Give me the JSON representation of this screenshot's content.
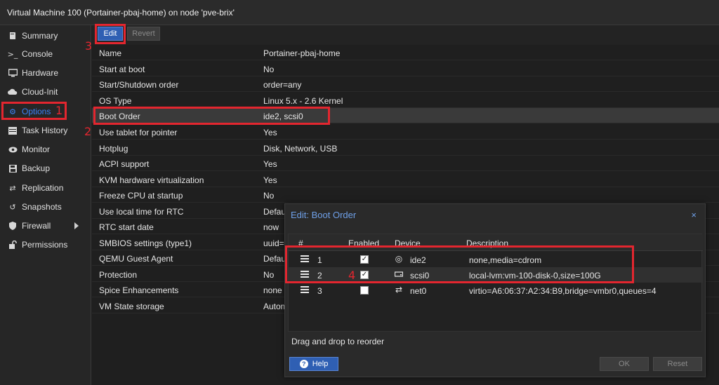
{
  "window": {
    "title": "Virtual Machine 100 (Portainer-pbaj-home) on node 'pve-brix'"
  },
  "sidebar": {
    "items": [
      {
        "label": "Summary",
        "icon": "book-icon"
      },
      {
        "label": "Console",
        "icon": "terminal-icon"
      },
      {
        "label": "Hardware",
        "icon": "monitor-icon"
      },
      {
        "label": "Cloud-Init",
        "icon": "cloud-icon"
      },
      {
        "label": "Options",
        "icon": "gear-icon",
        "active": true
      },
      {
        "label": "Task History",
        "icon": "list-icon"
      },
      {
        "label": "Monitor",
        "icon": "eye-icon"
      },
      {
        "label": "Backup",
        "icon": "floppy-icon"
      },
      {
        "label": "Replication",
        "icon": "retweet-icon"
      },
      {
        "label": "Snapshots",
        "icon": "history-icon"
      },
      {
        "label": "Firewall",
        "icon": "shield-icon"
      },
      {
        "label": "Permissions",
        "icon": "unlock-icon"
      }
    ]
  },
  "toolbar": {
    "edit_label": "Edit",
    "revert_label": "Revert"
  },
  "options": [
    {
      "key": "Name",
      "value": "Portainer-pbaj-home"
    },
    {
      "key": "Start at boot",
      "value": "No"
    },
    {
      "key": "Start/Shutdown order",
      "value": "order=any"
    },
    {
      "key": "OS Type",
      "value": "Linux 5.x - 2.6 Kernel"
    },
    {
      "key": "Boot Order",
      "value": "ide2, scsi0"
    },
    {
      "key": "Use tablet for pointer",
      "value": "Yes"
    },
    {
      "key": "Hotplug",
      "value": "Disk, Network, USB"
    },
    {
      "key": "ACPI support",
      "value": "Yes"
    },
    {
      "key": "KVM hardware virtualization",
      "value": "Yes"
    },
    {
      "key": "Freeze CPU at startup",
      "value": "No"
    },
    {
      "key": "Use local time for RTC",
      "value": "Defau"
    },
    {
      "key": "RTC start date",
      "value": "now"
    },
    {
      "key": "SMBIOS settings (type1)",
      "value": "uuid="
    },
    {
      "key": "QEMU Guest Agent",
      "value": "Defau"
    },
    {
      "key": "Protection",
      "value": "No"
    },
    {
      "key": "Spice Enhancements",
      "value": "none"
    },
    {
      "key": "VM State storage",
      "value": "Autom"
    }
  ],
  "dialog": {
    "title": "Edit: Boot Order",
    "close_glyph": "×",
    "columns": {
      "num": "#",
      "enabled": "Enabled",
      "device": "Device",
      "description": "Description"
    },
    "rows": [
      {
        "num": "1",
        "enabled": true,
        "device": "ide2",
        "device_icon": "disc-icon",
        "description": "none,media=cdrom"
      },
      {
        "num": "2",
        "enabled": true,
        "device": "scsi0",
        "device_icon": "hdd-icon",
        "description": "local-lvm:vm-100-disk-0,size=100G"
      },
      {
        "num": "3",
        "enabled": false,
        "device": "net0",
        "device_icon": "exchange-icon",
        "description": "virtio=A6:06:37:A2:34:B9,bridge=vmbr0,queues=4"
      }
    ],
    "hint": "Drag and drop to reorder",
    "help_label": "Help",
    "ok_label": "OK",
    "reset_label": "Reset"
  },
  "annotations": {
    "n1": "1",
    "n2": "2",
    "n3": "3",
    "n4": "4"
  },
  "colors": {
    "accent": "#2f5fb3",
    "callout": "#e3262f",
    "dialog_title": "#6fa0e8"
  }
}
